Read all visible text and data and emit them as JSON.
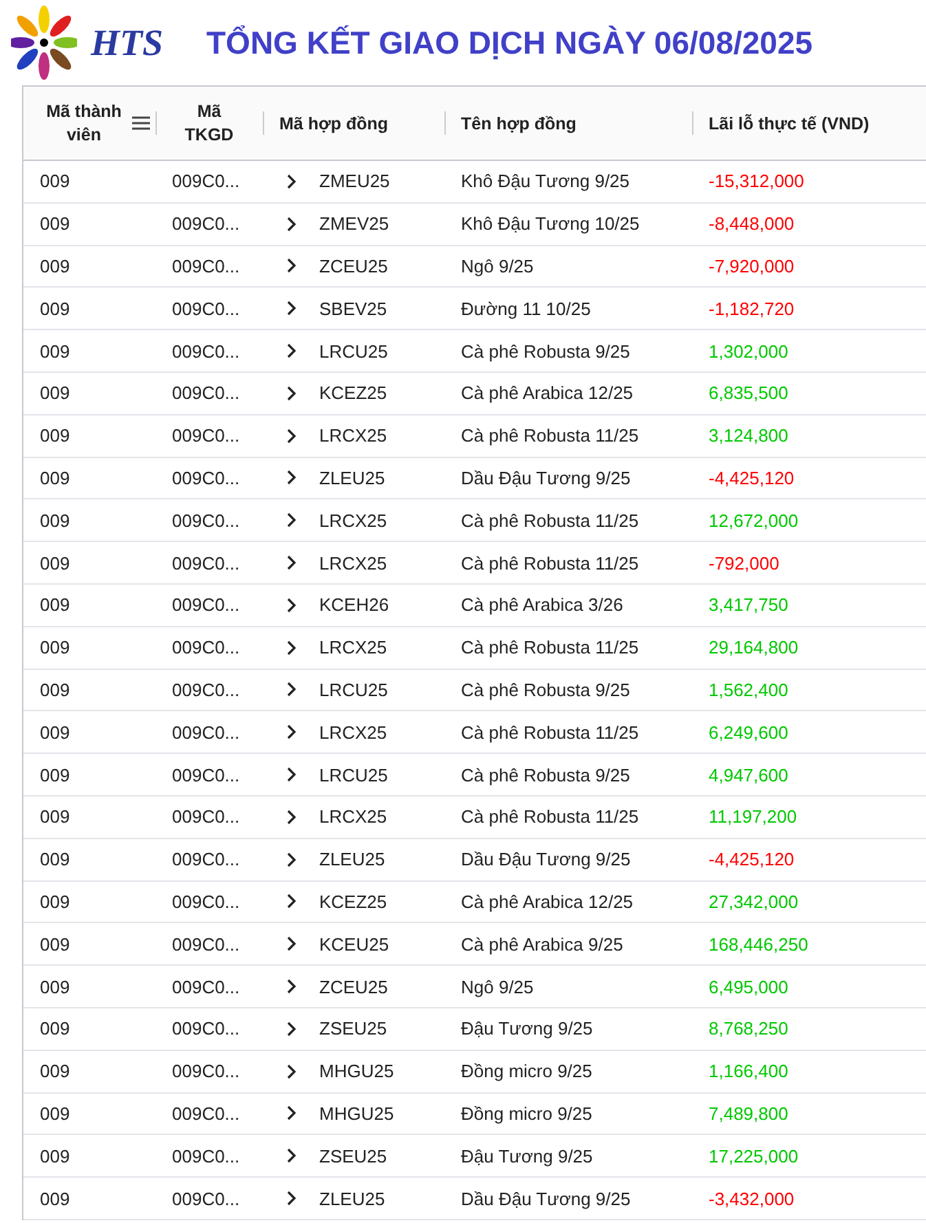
{
  "brand": "HTS",
  "title": "TỔNG KẾT GIAO DỊCH NGÀY 06/08/2025",
  "columns": [
    "Mã thành viên",
    "Mã TKGD",
    "Mã hợp đồng",
    "Tên hợp đồng",
    "Lãi lỗ thực tế (VND)"
  ],
  "rows": [
    {
      "member": "009",
      "account": "009C0...",
      "code": "ZMEU25",
      "name": "Khô Đậu Tương 9/25",
      "pnl": "-15,312,000",
      "color": "#ff0000"
    },
    {
      "member": "009",
      "account": "009C0...",
      "code": "ZMEV25",
      "name": "Khô Đậu Tương 10/25",
      "pnl": "-8,448,000",
      "color": "#ff0000"
    },
    {
      "member": "009",
      "account": "009C0...",
      "code": "ZCEU25",
      "name": "Ngô 9/25",
      "pnl": "-7,920,000",
      "color": "#ff0000"
    },
    {
      "member": "009",
      "account": "009C0...",
      "code": "SBEV25",
      "name": "Đường 11 10/25",
      "pnl": "-1,182,720",
      "color": "#ff0000"
    },
    {
      "member": "009",
      "account": "009C0...",
      "code": "LRCU25",
      "name": "Cà phê Robusta 9/25",
      "pnl": "1,302,000",
      "color": "#00c800"
    },
    {
      "member": "009",
      "account": "009C0...",
      "code": "KCEZ25",
      "name": "Cà phê Arabica 12/25",
      "pnl": "6,835,500",
      "color": "#00c800"
    },
    {
      "member": "009",
      "account": "009C0...",
      "code": "LRCX25",
      "name": "Cà phê Robusta 11/25",
      "pnl": "3,124,800",
      "color": "#00c800"
    },
    {
      "member": "009",
      "account": "009C0...",
      "code": "ZLEU25",
      "name": "Dầu Đậu Tương 9/25",
      "pnl": "-4,425,120",
      "color": "#ff0000"
    },
    {
      "member": "009",
      "account": "009C0...",
      "code": "LRCX25",
      "name": "Cà phê Robusta 11/25",
      "pnl": "12,672,000",
      "color": "#00c800"
    },
    {
      "member": "009",
      "account": "009C0...",
      "code": "LRCX25",
      "name": "Cà phê Robusta 11/25",
      "pnl": "-792,000",
      "color": "#ff0000"
    },
    {
      "member": "009",
      "account": "009C0...",
      "code": "KCEH26",
      "name": "Cà phê Arabica 3/26",
      "pnl": "3,417,750",
      "color": "#00c800"
    },
    {
      "member": "009",
      "account": "009C0...",
      "code": "LRCX25",
      "name": "Cà phê Robusta 11/25",
      "pnl": "29,164,800",
      "color": "#00c800"
    },
    {
      "member": "009",
      "account": "009C0...",
      "code": "LRCU25",
      "name": "Cà phê Robusta 9/25",
      "pnl": "1,562,400",
      "color": "#00c800"
    },
    {
      "member": "009",
      "account": "009C0...",
      "code": "LRCX25",
      "name": "Cà phê Robusta 11/25",
      "pnl": "6,249,600",
      "color": "#00c800"
    },
    {
      "member": "009",
      "account": "009C0...",
      "code": "LRCU25",
      "name": "Cà phê Robusta 9/25",
      "pnl": "4,947,600",
      "color": "#00c800"
    },
    {
      "member": "009",
      "account": "009C0...",
      "code": "LRCX25",
      "name": "Cà phê Robusta 11/25",
      "pnl": "11,197,200",
      "color": "#00c800"
    },
    {
      "member": "009",
      "account": "009C0...",
      "code": "ZLEU25",
      "name": "Dầu Đậu Tương 9/25",
      "pnl": "-4,425,120",
      "color": "#ff0000"
    },
    {
      "member": "009",
      "account": "009C0...",
      "code": "KCEZ25",
      "name": "Cà phê Arabica 12/25",
      "pnl": "27,342,000",
      "color": "#00c800"
    },
    {
      "member": "009",
      "account": "009C0...",
      "code": "KCEU25",
      "name": "Cà phê Arabica 9/25",
      "pnl": "168,446,250",
      "color": "#00c800"
    },
    {
      "member": "009",
      "account": "009C0...",
      "code": "ZCEU25",
      "name": "Ngô 9/25",
      "pnl": "6,495,000",
      "color": "#00c800"
    },
    {
      "member": "009",
      "account": "009C0...",
      "code": "ZSEU25",
      "name": "Đậu Tương 9/25",
      "pnl": "8,768,250",
      "color": "#00c800"
    },
    {
      "member": "009",
      "account": "009C0...",
      "code": "MHGU25",
      "name": "Đồng micro 9/25",
      "pnl": "1,166,400",
      "color": "#00c800"
    },
    {
      "member": "009",
      "account": "009C0...",
      "code": "MHGU25",
      "name": "Đồng micro 9/25",
      "pnl": "7,489,800",
      "color": "#00c800"
    },
    {
      "member": "009",
      "account": "009C0...",
      "code": "ZSEU25",
      "name": "Đậu Tương 9/25",
      "pnl": "17,225,000",
      "color": "#00c800"
    },
    {
      "member": "009",
      "account": "009C0...",
      "code": "ZLEU25",
      "name": "Dầu Đậu Tương 9/25",
      "pnl": "-3,432,000",
      "color": "#ff0000"
    }
  ]
}
